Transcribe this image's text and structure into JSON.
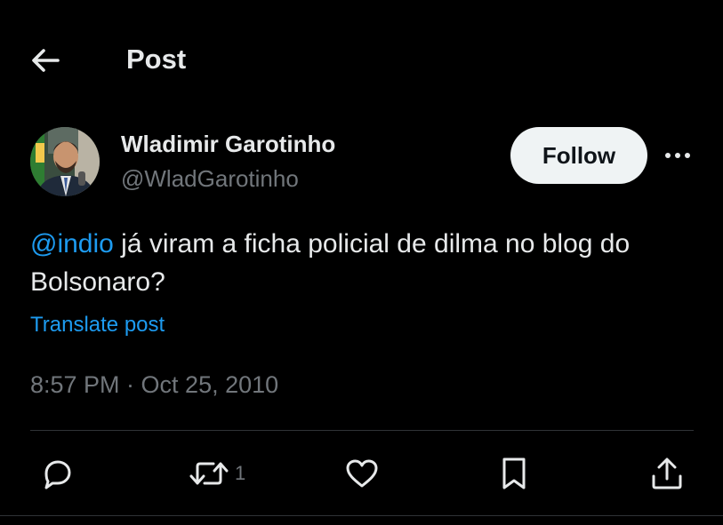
{
  "header": {
    "title": "Post",
    "back_icon": "arrow-left-icon"
  },
  "author": {
    "display_name": "Wladimir Garotinho",
    "handle": "@WladGarotinho"
  },
  "follow_button": {
    "label": "Follow"
  },
  "more_icon": "more-horizontal-icon",
  "tweet": {
    "mention": "@indio",
    "text": " já viram a ficha policial de dilma no blog do Bolsonaro?",
    "translate_label": "Translate post",
    "timestamp": "8:57 PM · Oct 25, 2010"
  },
  "actions": {
    "reply": {
      "icon": "reply-icon"
    },
    "repost": {
      "icon": "repost-icon",
      "count": "1"
    },
    "like": {
      "icon": "heart-icon"
    },
    "bookmark": {
      "icon": "bookmark-icon"
    },
    "share": {
      "icon": "share-icon"
    }
  },
  "colors": {
    "background": "#000000",
    "text": "#e7e9ea",
    "secondary": "#71767b",
    "accent": "#1d9bf0",
    "follow_bg": "#eff3f4",
    "divider": "#2f3336"
  }
}
